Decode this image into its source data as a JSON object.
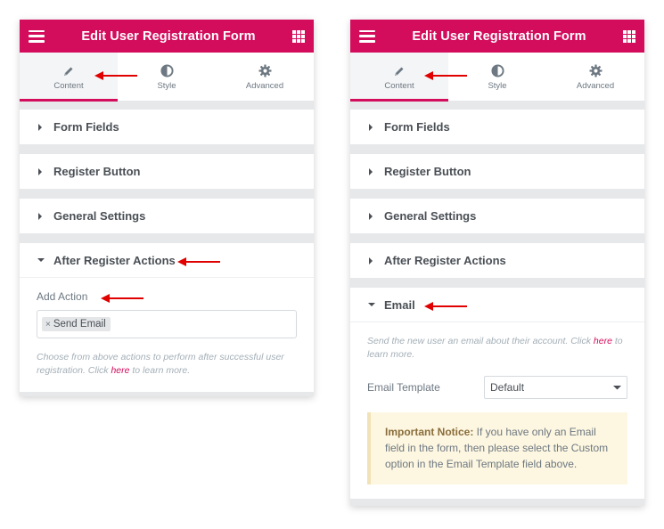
{
  "colors": {
    "accent": "#d30c5c",
    "arrow": "#e00000"
  },
  "left_panel": {
    "header": {
      "title": "Edit User Registration Form",
      "menu_icon": "hamburger-icon",
      "apps_icon": "grid-icon"
    },
    "tabs": [
      {
        "label": "Content",
        "icon": "pencil-icon",
        "active": true
      },
      {
        "label": "Style",
        "icon": "half-circle-icon",
        "active": false
      },
      {
        "label": "Advanced",
        "icon": "gear-icon",
        "active": false
      }
    ],
    "sections": [
      {
        "label": "Form Fields"
      },
      {
        "label": "Register Button"
      },
      {
        "label": "General Settings"
      },
      {
        "label": "After Register Actions",
        "open": true
      }
    ],
    "add_action": {
      "label": "Add Action",
      "tag": "Send Email",
      "tag_remove": "×",
      "desc_before": "Choose from above actions to perform after successful user registration. Click ",
      "desc_link": "here",
      "desc_after": " to learn more."
    }
  },
  "right_panel": {
    "header": {
      "title": "Edit User Registration Form",
      "menu_icon": "hamburger-icon",
      "apps_icon": "grid-icon"
    },
    "tabs": [
      {
        "label": "Content",
        "icon": "pencil-icon",
        "active": true
      },
      {
        "label": "Style",
        "icon": "half-circle-icon",
        "active": false
      },
      {
        "label": "Advanced",
        "icon": "gear-icon",
        "active": false
      }
    ],
    "sections": [
      {
        "label": "Form Fields"
      },
      {
        "label": "Register Button"
      },
      {
        "label": "General Settings"
      },
      {
        "label": "After Register Actions"
      },
      {
        "label": "Email",
        "open": true
      }
    ],
    "email": {
      "desc_before": "Send the new user an email about their account. Click ",
      "desc_link": "here",
      "desc_after": " to learn more.",
      "template_label": "Email Template",
      "template_value": "Default",
      "notice_title": "Important Notice:",
      "notice_text": " If you have only an Email field in the form, then please select the Custom option in the Email Template field above."
    }
  }
}
